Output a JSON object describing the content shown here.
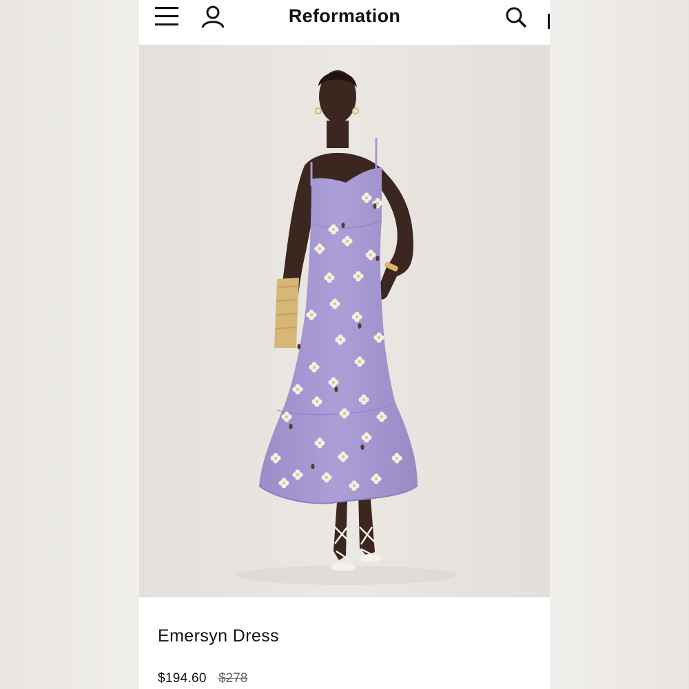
{
  "header": {
    "brand": "Reformation",
    "icons": [
      "hamburger-menu-icon",
      "account-icon",
      "search-icon"
    ]
  },
  "hero": {
    "subject": "model wearing lavender floral midi dress with clutch"
  },
  "product": {
    "name": "Emersyn Dress",
    "price_sale": "$194.60",
    "price_original": "$278"
  },
  "colors": {
    "dress": "#a497d2",
    "background": "#e7e4df",
    "text": "#111111"
  }
}
